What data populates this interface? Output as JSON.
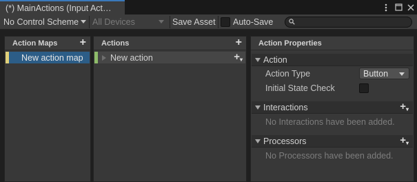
{
  "window": {
    "tab_title": "(*) MainActions (Input Act…",
    "menu_icon": "kebab-menu-icon",
    "maximize_icon": "maximize-icon",
    "close_icon": "close-icon"
  },
  "toolbar": {
    "control_scheme": "No Control Scheme",
    "devices": "All Devices",
    "save_asset": "Save Asset",
    "auto_save": "Auto-Save",
    "auto_save_checked": false,
    "search_value": ""
  },
  "action_maps": {
    "title": "Action Maps",
    "items": [
      "New action map"
    ],
    "selected_color": "#2c5d87",
    "marker_color": "#e0d07a"
  },
  "actions": {
    "title": "Actions",
    "items": [
      "New action"
    ],
    "marker_color": "#8fbc6a"
  },
  "properties": {
    "title": "Action Properties",
    "action_section": "Action",
    "action_type_label": "Action Type",
    "action_type_value": "Button",
    "initial_state_label": "Initial State Check",
    "initial_state_checked": false,
    "interactions_section": "Interactions",
    "interactions_empty": "No Interactions have been added.",
    "processors_section": "Processors",
    "processors_empty": "No Processors have been added."
  },
  "colors": {
    "accent_blue": "#3a79bb",
    "panel_bg": "#383838",
    "header_bg": "#3c3c3c"
  }
}
